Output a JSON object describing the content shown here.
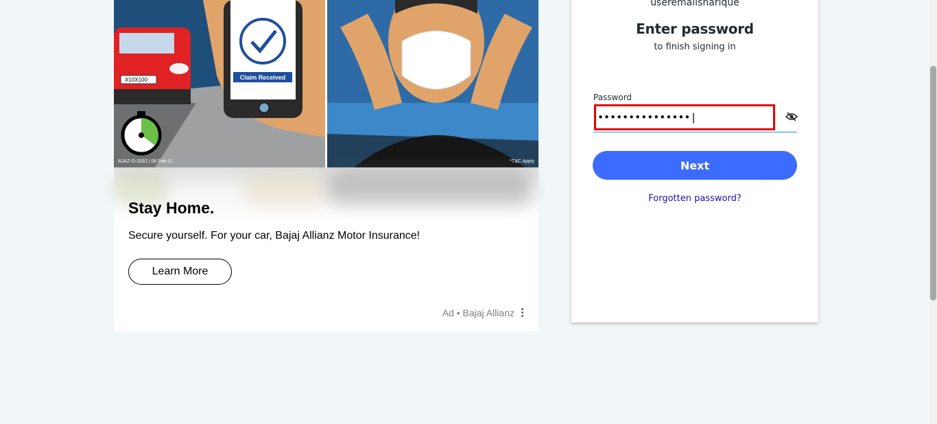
{
  "ad": {
    "image_labels": {
      "phone_badge": "Claim Received",
      "number_plate": "X10X100",
      "disclaimer_left": "BJAZ-O-2052 | 08 Feb 21",
      "disclaimer_right": "*T&C Apply"
    },
    "title": "Stay Home.",
    "text": "Secure yourself. For your car, Bajaj Allianz Motor Insurance!",
    "cta_label": "Learn More",
    "sponsor": "Ad • Bajaj Allianz",
    "menu_icon": "kebab-menu-icon"
  },
  "login": {
    "username": "useremailsharique",
    "heading": "Enter password",
    "subheading": "to finish signing in",
    "password_label": "Password",
    "password_value": "•••••••••••••••|",
    "toggle_icon": "eye-slash-icon",
    "next_label": "Next",
    "forgot_label": "Forgotten password?"
  },
  "colors": {
    "page_bg": "#f1f6f9",
    "primary_button": "#3b6cff",
    "link": "#1d0fb0",
    "error_border": "#e60000"
  }
}
